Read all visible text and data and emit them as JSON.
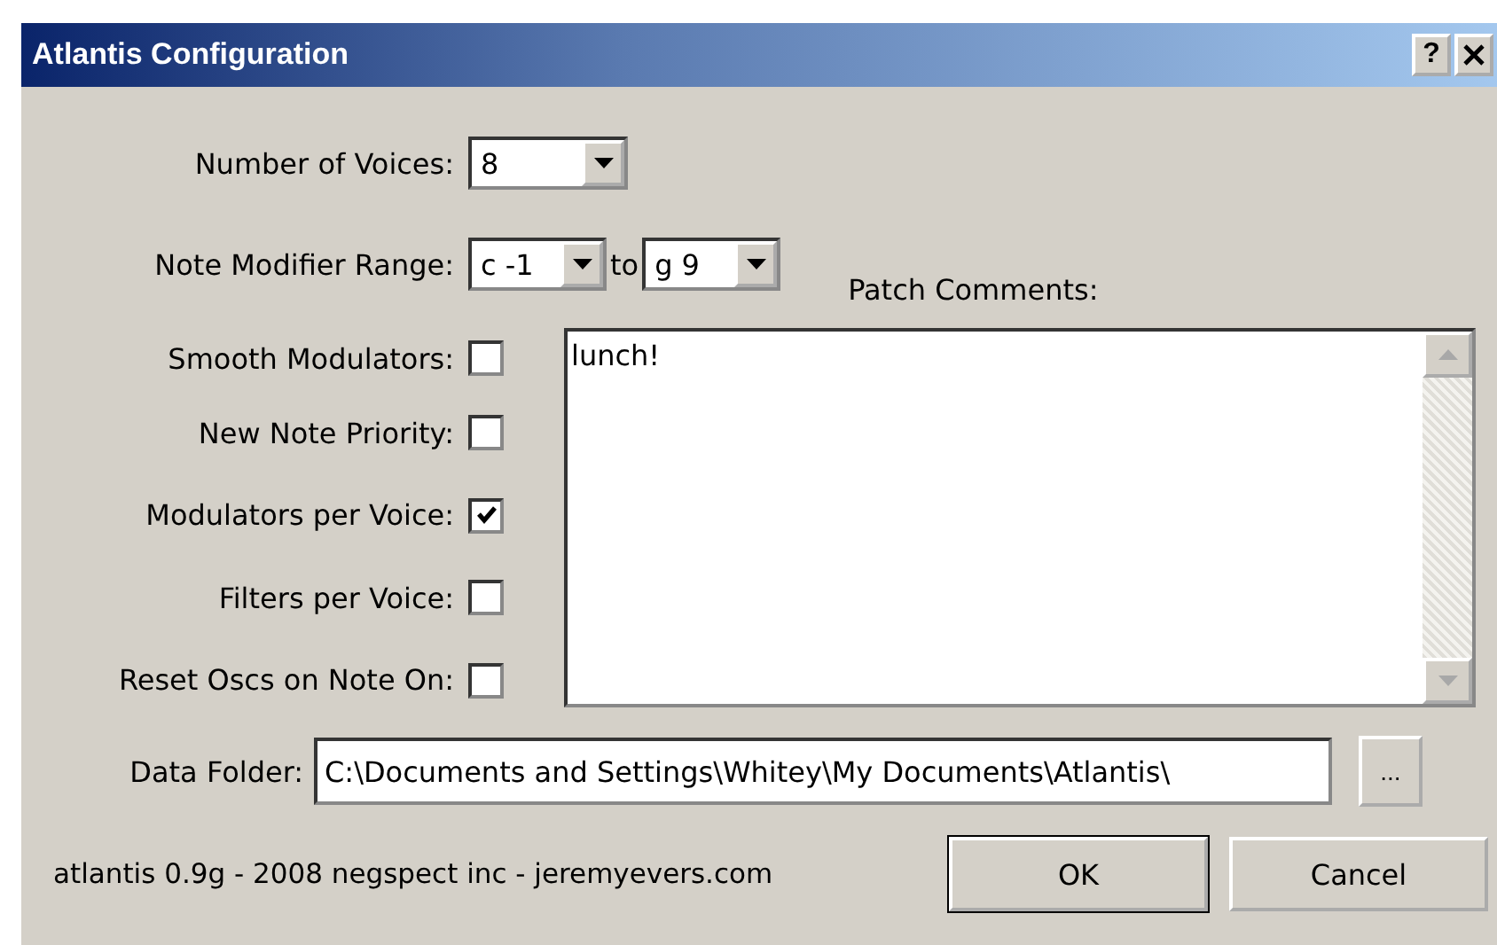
{
  "window": {
    "title": "Atlantis Configuration",
    "help_button": "?"
  },
  "voices": {
    "label": "Number of Voices:",
    "value": "8"
  },
  "range": {
    "label": "Note Modifier Range:",
    "from": "c -1",
    "joiner": "to",
    "to": "g 9"
  },
  "comments": {
    "label": "Patch Comments:",
    "value": "lunch!"
  },
  "options": [
    {
      "label": "Smooth Modulators:",
      "checked": false
    },
    {
      "label": "New Note Priority:",
      "checked": false
    },
    {
      "label": "Modulators per Voice:",
      "checked": true
    },
    {
      "label": "Filters per Voice:",
      "checked": false
    },
    {
      "label": "Reset Oscs on Note On:",
      "checked": false
    }
  ],
  "folder": {
    "label": "Data Folder:",
    "value": "C:\\Documents and Settings\\Whitey\\My Documents\\Atlantis\\",
    "browse": "..."
  },
  "footer": {
    "credit": "atlantis 0.9g - 2008 negspect inc - jeremyevers.com",
    "buttons": [
      "OK",
      "Cancel"
    ]
  }
}
